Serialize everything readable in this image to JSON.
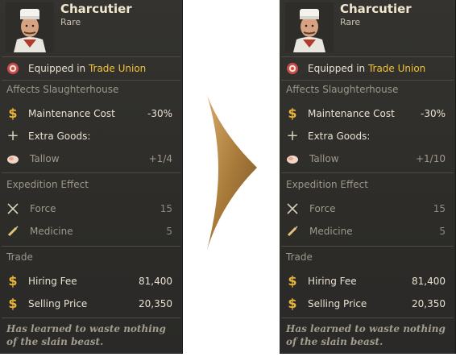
{
  "left": {
    "title": "Charcutier",
    "rarity": "Rare",
    "equipped_prefix": "Equipped in ",
    "equipped_place": "Trade Union",
    "affects": "Affects Slaughterhouse",
    "maintenance_label": "Maintenance Cost",
    "maintenance_value": "-30%",
    "extra_goods_label": "Extra Goods:",
    "tallow_label": "Tallow",
    "tallow_value": "+1/4",
    "expedition_label": "Expedition Effect",
    "force_label": "Force",
    "force_value": "15",
    "medicine_label": "Medicine",
    "medicine_value": "5",
    "trade_label": "Trade",
    "hiring_label": "Hiring Fee",
    "hiring_value": "81,400",
    "selling_label": "Selling Price",
    "selling_value": "20,350",
    "flavor": "Has learned to waste nothing of the slain beast."
  },
  "right": {
    "title": "Charcutier",
    "rarity": "Rare",
    "equipped_prefix": "Equipped in ",
    "equipped_place": "Trade Union",
    "affects": "Affects Slaughterhouse",
    "maintenance_label": "Maintenance Cost",
    "maintenance_value": "-30%",
    "extra_goods_label": "Extra Goods:",
    "tallow_label": "Tallow",
    "tallow_value": "+1/10",
    "expedition_label": "Expedition Effect",
    "force_label": "Force",
    "force_value": "15",
    "medicine_label": "Medicine",
    "medicine_value": "5",
    "trade_label": "Trade",
    "hiring_label": "Hiring Fee",
    "hiring_value": "81,400",
    "selling_label": "Selling Price",
    "selling_value": "20,350",
    "flavor": "Has learned to waste nothing of the slain beast."
  },
  "colors": {
    "panel": "#2f2f2c",
    "accent_gold": "#f3c239",
    "arrow": "#a87a3a"
  },
  "icons": {
    "portrait": "chef-portrait",
    "guild": "guild-emblem-icon",
    "currency": "dollar-icon",
    "extra": "plus-icon",
    "tallow": "tallow-icon",
    "force": "crossed-swords-icon",
    "medicine": "syringe-icon",
    "comparison": "arrow-right-icon"
  }
}
